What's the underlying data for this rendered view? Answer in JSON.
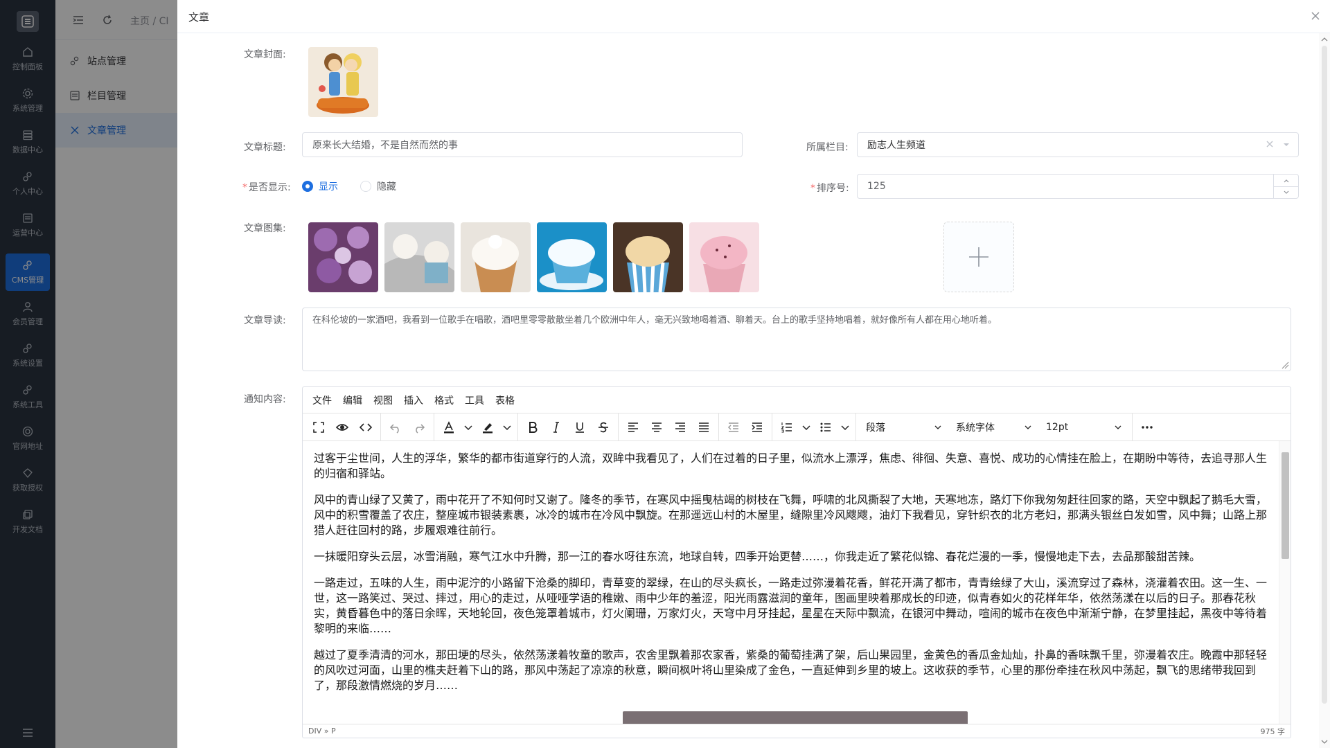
{
  "rail": {
    "items": [
      {
        "label": "控制面板",
        "icon": "home-icon"
      },
      {
        "label": "系统管理",
        "icon": "gear-icon"
      },
      {
        "label": "数据中心",
        "icon": "database-icon"
      },
      {
        "label": "个人中心",
        "icon": "gears-icon"
      },
      {
        "label": "运营中心",
        "icon": "list-icon"
      },
      {
        "label": "CMS管理",
        "icon": "gears-icon",
        "active": true
      },
      {
        "label": "会员管理",
        "icon": "user-icon"
      },
      {
        "label": "系统设置",
        "icon": "gears-icon"
      },
      {
        "label": "系统工具",
        "icon": "gears-icon"
      },
      {
        "label": "官网地址",
        "icon": "globe-icon"
      },
      {
        "label": "获取授权",
        "icon": "diamond-icon"
      },
      {
        "label": "开发文档",
        "icon": "copy-icon"
      }
    ]
  },
  "topbar": {
    "breadcrumb": "主页 / CI"
  },
  "subnav": {
    "items": [
      {
        "label": "站点管理"
      },
      {
        "label": "栏目管理"
      },
      {
        "label": "文章管理",
        "active": true
      }
    ]
  },
  "drawer": {
    "title": "文章",
    "labels": {
      "cover": "文章封面:",
      "title": "文章标题:",
      "column": "所属栏目:",
      "display": "是否显示:",
      "sort": "排序号:",
      "gallery": "文章图集:",
      "intro": "文章导读:",
      "content": "通知内容:"
    },
    "title_value": "原来长大结婚，不是自然而然的事",
    "column_value": "励志人生频道",
    "display_options": [
      {
        "label": "显示",
        "checked": true
      },
      {
        "label": "隐藏",
        "checked": false
      }
    ],
    "sort_value": "125",
    "intro_value": "在科伦坡的一家酒吧，我看到一位歌手在唱歌，酒吧里零零散散坐着几个欧洲中年人，毫无兴致地喝着酒、聊着天。台上的歌手坚持地唱着，就好像所有人都在用心地听着。"
  },
  "editor": {
    "menus": [
      "文件",
      "编辑",
      "视图",
      "插入",
      "格式",
      "工具",
      "表格"
    ],
    "block_format": "段落",
    "font_family": "系统字体",
    "font_size": "12pt",
    "paragraphs": [
      "过客于尘世间，人生的浮华，繁华的都市街道穿行的人流，双眸中我看见了，人们在过着的日子里，似流水上漂浮，焦虑、徘徊、失意、喜悦、成功的心情挂在脸上，在期盼中等待，去追寻那人生的归宿和驿站。",
      "风中的青山绿了又黄了，雨中花开了不知何时又谢了。隆冬的季节，在寒风中摇曳枯竭的树枝在飞舞，呼啸的北风撕裂了大地，天寒地冻，路灯下你我匆匆赶往回家的路，天空中飘起了鹅毛大雪，风中的积雪覆盖了农庄，整座城市银装素裹，冰冷的城市在冷风中飘旋。在那遥远山村的木屋里，缝隙里冷风飕飕，油灯下我看见，穿针织衣的北方老妇，那满头银丝白发如雪，风中舞；山路上那猎人赶往回村的路，步履艰难往前行。",
      "一抹暖阳穿头云层，冰雪消融，寒气江水中升腾，那一江的春水呀往东流，地球自转，四季开始更替……，你我走近了繁花似锦、春花烂漫的一季，慢慢地走下去，去品那酸甜苦辣。",
      "一路走过，五味的人生，雨中泥泞的小路留下沧桑的脚印，青草变的翠绿，在山的尽头疯长，一路走过弥漫着花香，鲜花开满了都市，青青绘绿了大山，溪流穿过了森林，浇灌着农田。这一生、一世，这一路笑过、哭过、摔过，用心的走过，从哑哑学语的稚嫩、雨中少年的羞涩，阳光雨露滋润的童年，图画里映着那成长的印迹，似青春如火的花样年华，依然荡漾在以后的日子。那春花秋实，黄昏暮色中的落日余晖，天地轮回，夜色笼罩着城市，灯火阑珊，万家灯火，天穹中月牙挂起，星星在天际中飘流，在银河中舞动，喧闹的城市在夜色中渐渐宁静，在梦里挂起，黑夜中等待着黎明的来临……",
      "越过了夏季清清的河水，那田埂的尽头，依然荡漾着牧童的歌声，农舍里飘着那农家香，紫桑的葡萄挂满了架，后山果园里，金黄色的香瓜金灿灿，扑鼻的香味飘千里，弥漫着农庄。晚霞中那轻轻的风吹过河面，山里的樵夫赶着下山的路，那风中荡起了凉凉的秋意，瞬间枫叶将山里染成了金色，一直延伸到乡里的坡上。这收获的季节，心里的那份牵挂在秋风中荡起，飘飞的思绪带我回到了，那段激情燃烧的岁月……"
    ],
    "path": "DIV » P",
    "word_count": "975 字"
  },
  "colors": {
    "accent": "#1e6fe0",
    "rail_bg": "#2b3340",
    "required": "#f56c6c"
  }
}
